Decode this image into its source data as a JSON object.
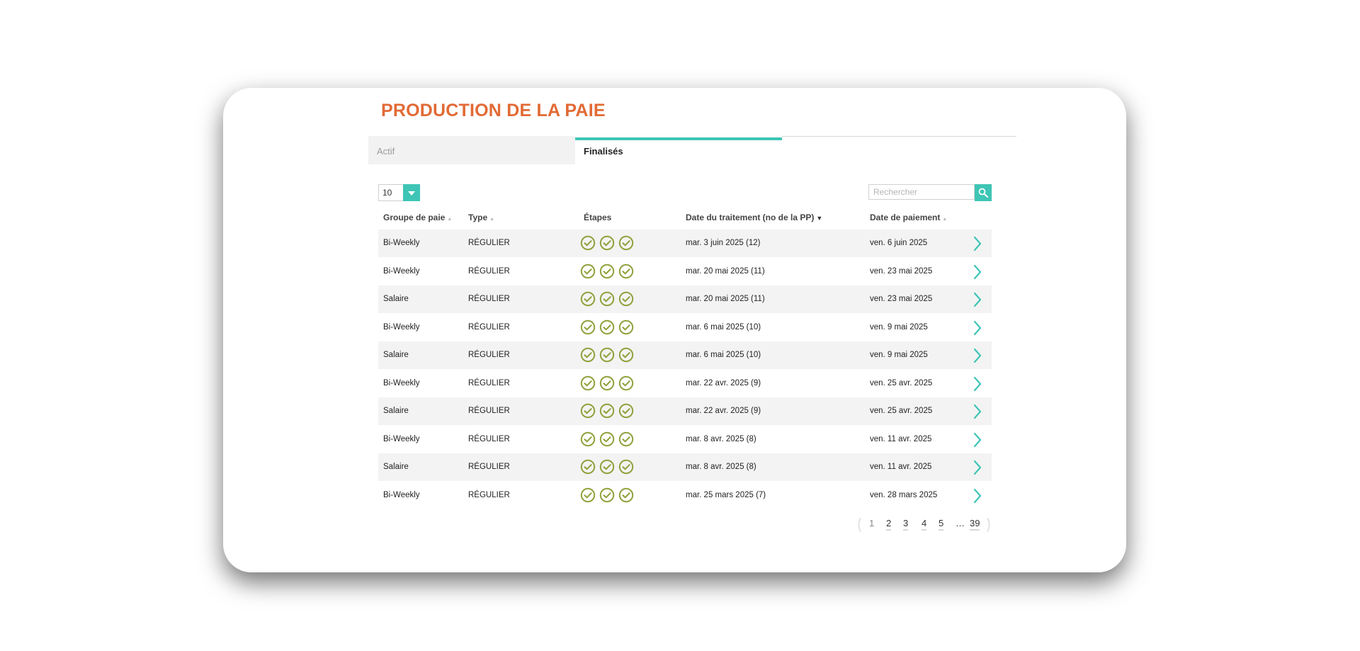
{
  "page": {
    "title": "PRODUCTION DE LA PAIE"
  },
  "tabs": [
    {
      "label": "Actif",
      "active": false
    },
    {
      "label": "Finalisés",
      "active": true
    }
  ],
  "controls": {
    "page_size": "10",
    "search_placeholder": "Rechercher"
  },
  "table": {
    "headers": {
      "groupe": "Groupe de paie",
      "type": "Type",
      "etapes": "Étapes",
      "date_traitement": "Date du traitement (no de la PP)",
      "date_paiement": "Date de paiement"
    },
    "sorted_column": "date_traitement",
    "sort_direction": "desc",
    "rows": [
      {
        "groupe": "Bi-Weekly",
        "type": "RÉGULIER",
        "etapes_completed": 3,
        "date_traitement": "mar. 3 juin 2025 (12)",
        "date_paiement": "ven. 6 juin 2025"
      },
      {
        "groupe": "Bi-Weekly",
        "type": "RÉGULIER",
        "etapes_completed": 3,
        "date_traitement": "mar. 20 mai 2025 (11)",
        "date_paiement": "ven. 23 mai 2025"
      },
      {
        "groupe": "Salaire",
        "type": "RÉGULIER",
        "etapes_completed": 3,
        "date_traitement": "mar. 20 mai 2025 (11)",
        "date_paiement": "ven. 23 mai 2025"
      },
      {
        "groupe": "Bi-Weekly",
        "type": "RÉGULIER",
        "etapes_completed": 3,
        "date_traitement": "mar. 6 mai 2025 (10)",
        "date_paiement": "ven. 9 mai 2025"
      },
      {
        "groupe": "Salaire",
        "type": "RÉGULIER",
        "etapes_completed": 3,
        "date_traitement": "mar. 6 mai 2025 (10)",
        "date_paiement": "ven. 9 mai 2025"
      },
      {
        "groupe": "Bi-Weekly",
        "type": "RÉGULIER",
        "etapes_completed": 3,
        "date_traitement": "mar. 22 avr. 2025 (9)",
        "date_paiement": "ven. 25 avr. 2025"
      },
      {
        "groupe": "Salaire",
        "type": "RÉGULIER",
        "etapes_completed": 3,
        "date_traitement": "mar. 22 avr. 2025 (9)",
        "date_paiement": "ven. 25 avr. 2025"
      },
      {
        "groupe": "Bi-Weekly",
        "type": "RÉGULIER",
        "etapes_completed": 3,
        "date_traitement": "mar. 8 avr. 2025 (8)",
        "date_paiement": "ven. 11 avr. 2025"
      },
      {
        "groupe": "Salaire",
        "type": "RÉGULIER",
        "etapes_completed": 3,
        "date_traitement": "mar. 8 avr. 2025 (8)",
        "date_paiement": "ven. 11 avr. 2025"
      },
      {
        "groupe": "Bi-Weekly",
        "type": "RÉGULIER",
        "etapes_completed": 3,
        "date_traitement": "mar. 25 mars 2025 (7)",
        "date_paiement": "ven. 28 mars 2025"
      }
    ]
  },
  "pagination": {
    "pages": [
      "1",
      "2",
      "3",
      "4",
      "5",
      "…",
      "39"
    ],
    "current": "1"
  },
  "icons": {
    "step_check": "check-circle-icon",
    "row_open": "chevron-right-icon",
    "search": "search-icon",
    "dropdown": "chevron-down-icon"
  },
  "colors": {
    "title": "#e26a35",
    "accent": "#3ec5b5",
    "check": "#8fa23c",
    "row_stripe": "#f3f3f3"
  }
}
